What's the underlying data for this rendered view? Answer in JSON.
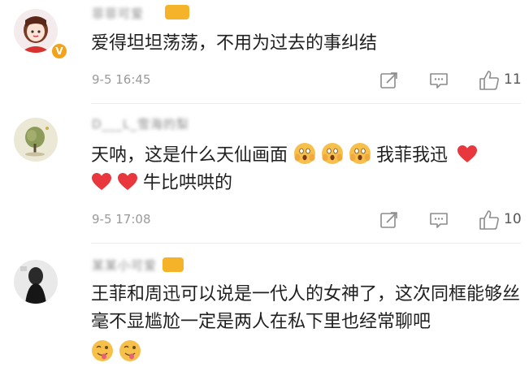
{
  "comments": [
    {
      "username": "菲菲可爱",
      "text": "爱得坦坦荡荡，不用为过去的事纠结",
      "time": "9-5 16:45",
      "likes": "11",
      "avatar": "anime-girl-avatar",
      "verified": true
    },
    {
      "username": "D___L_雪海的梨",
      "text_line1": "天呐，这是什么天仙画面",
      "text_line1_tail": "我菲我迅",
      "text_line2": "牛比哄哄的",
      "time": "9-5 17:08",
      "likes": "10",
      "avatar": "tree-avatar"
    },
    {
      "username": "某某小可爱",
      "text": "王菲和周迅可以说是一代人的女神了，这次同框能够丝毫不显尴尬一定是两人在私下里也经常聊吧",
      "avatar": "person-avatar"
    }
  ],
  "colors": {
    "heart": "#e8383d",
    "emoji_face": "#f6c04b",
    "meta_text": "#9a9a9a",
    "badge": "#f3a21a"
  }
}
